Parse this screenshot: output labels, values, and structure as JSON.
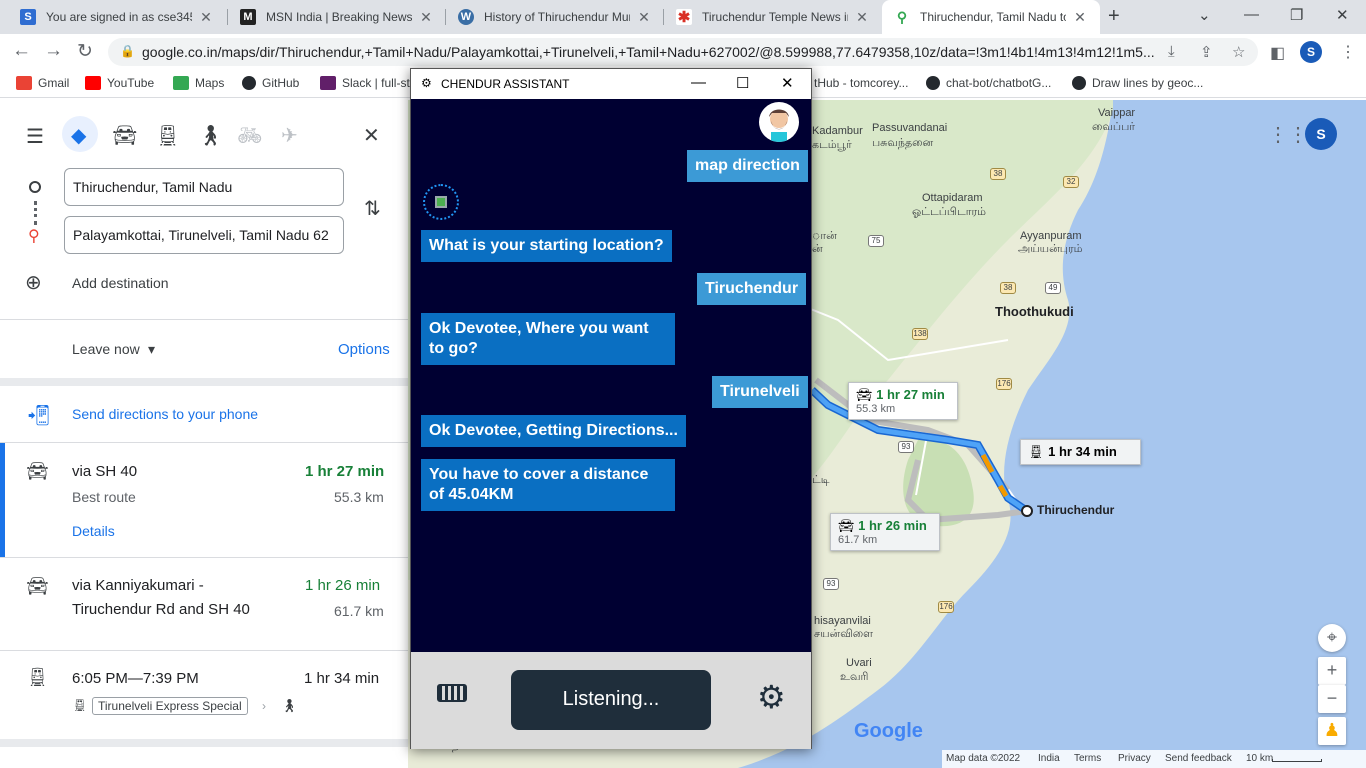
{
  "browser": {
    "tabs": [
      {
        "title": "You are signed in as cse345",
        "icon": "s-icon",
        "color": "#2f6dd1",
        "glyph": "S"
      },
      {
        "title": "MSN India | Breaking News, E",
        "icon": "msn-icon",
        "color": "#222222",
        "glyph": "M"
      },
      {
        "title": "History of Thiruchendur Mur",
        "icon": "wordpress-icon",
        "color": "#3a6ea5",
        "glyph": "W"
      },
      {
        "title": "Tiruchendur Temple News in",
        "icon": "temple-news-icon",
        "color": "#d93025",
        "glyph": "✱"
      },
      {
        "title": "Thiruchendur, Tamil Nadu to",
        "icon": "maps-pin-icon",
        "color": "#34a853",
        "glyph": "⚲"
      }
    ],
    "url": "google.co.in/maps/dir/Thiruchendur,+Tamil+Nadu/Palayamkottai,+Tirunelveli,+Tamil+Nadu+627002/@8.599988,77.6479358,10z/data=!3m1!4b1!4m13!4m12!1m5...",
    "profile_initial": "S",
    "bookmarks": [
      {
        "label": "Gmail",
        "color": "#ea4335"
      },
      {
        "label": "YouTube",
        "color": "#ff0000"
      },
      {
        "label": "Maps",
        "color": "#34a853"
      },
      {
        "label": "GitHub",
        "color": "#24292e"
      },
      {
        "label": "Slack | full-st",
        "color": "#611f69"
      },
      {
        "label": "tHub - tomcorey...",
        "color": "#24292e"
      },
      {
        "label": "chat-bot/chatbotG...",
        "color": "#24292e"
      },
      {
        "label": "Draw lines by geoc...",
        "color": "#24292e"
      }
    ]
  },
  "directions": {
    "origin": "Thiruchendur, Tamil Nadu",
    "destination": "Palayamkottai, Tirunelveli, Tamil Nadu 62",
    "add_destination": "Add destination",
    "leave_now": "Leave now",
    "options": "Options",
    "send_to_phone": "Send directions to your phone",
    "routes": [
      {
        "via": "via SH 40",
        "time": "1 hr 27 min",
        "note": "Best route",
        "distance": "55.3 km",
        "details": "Details"
      },
      {
        "via_line1": "via Kanniyakumari -",
        "via_line2": "Tiruchendur Rd and SH 40",
        "time": "1 hr 26 min",
        "distance": "61.7 km"
      },
      {
        "schedule": "6:05 PM—7:39 PM",
        "time": "1 hr 34 min",
        "train": "Tirunelveli Express Special"
      }
    ]
  },
  "map": {
    "labels": {
      "kadambur": "Kadambur",
      "kadambur_ta": "கடம்பூர்",
      "passuvandanai": "Passuvandanai",
      "passuvandanai_ta": "பசுவந்தனை",
      "vaippar": "Vaippar",
      "vaippar_ta": "வைப்பர்",
      "ottapidaram": "Ottapidaram",
      "ottapidaram_ta": "ஓட்டப்பிடாரம்",
      "ayyanpuram": "Ayyanpuram",
      "ayyanpuram_ta": "அய்யன்புரம்",
      "thoothukudi": "Thoothukudi",
      "thiruchendur": "Thiruchendur",
      "thisayanvilai": "hisayanvilai",
      "thisayanvilai_ta": "சயன்விளை",
      "uvari": "Uvari",
      "uvari_ta": "உவரி",
      "frag_an": "ான்",
      "frag_an2": "ன்",
      "frag_tti": "ட்டி",
      "bottom_ta": "நாகர்கோவில்"
    },
    "route_badges": [
      "38",
      "32",
      "75",
      "38",
      "49",
      "138",
      "176",
      "93",
      "93",
      "176"
    ],
    "callouts": {
      "car1_time": "1 hr 27 min",
      "car1_dist": "55.3 km",
      "train_time": "1 hr 34 min",
      "car2_time": "1 hr 26 min",
      "car2_dist": "61.7 km"
    },
    "footer": {
      "data": "Map data ©2022",
      "india": "India",
      "terms": "Terms",
      "privacy": "Privacy",
      "feedback": "Send feedback",
      "scale": "10 km"
    },
    "google": "Google"
  },
  "assistant": {
    "title": "CHENDUR ASSISTANT",
    "messages": [
      {
        "from": "user",
        "text": "map direction"
      },
      {
        "from": "bot",
        "text": "What is your starting location?"
      },
      {
        "from": "user",
        "text": "Tiruchendur"
      },
      {
        "from": "bot",
        "text": "Ok Devotee, Where you want to go?"
      },
      {
        "from": "user",
        "text": "Tirunelveli"
      },
      {
        "from": "bot",
        "text": "Ok Devotee, Getting Directions..."
      },
      {
        "from": "bot",
        "text": "You have to cover a distance of 45.04KM"
      }
    ],
    "listening": "Listening..."
  }
}
